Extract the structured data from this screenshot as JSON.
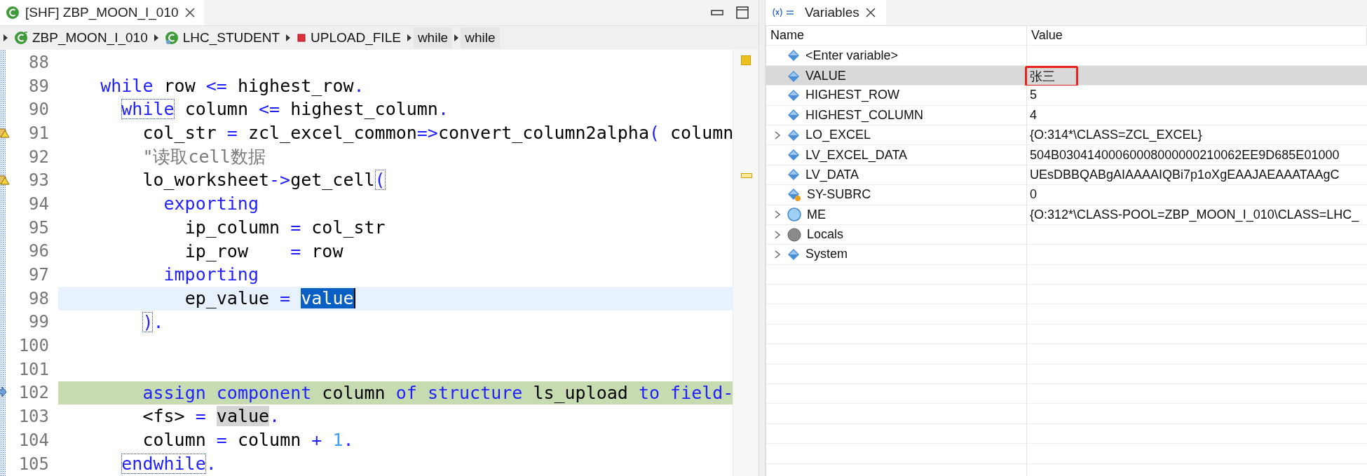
{
  "editor": {
    "tab": {
      "title": "[SHF] ZBP_MOON_I_010",
      "selected": true
    },
    "breadcrumb": [
      {
        "kind": "global-class",
        "label": "ZBP_MOON_I_010"
      },
      {
        "kind": "local-class",
        "label": "LHC_STUDENT"
      },
      {
        "kind": "method",
        "label": "UPLOAD_FILE"
      },
      {
        "kind": "block",
        "label": "while"
      },
      {
        "kind": "block",
        "label": "while"
      }
    ],
    "lines": [
      {
        "number": "88",
        "cursor_line": false,
        "execution_point": false,
        "warning": false
      },
      {
        "number": "89",
        "cursor_line": false,
        "execution_point": false,
        "warning": false,
        "tokens": [
          {
            "kind": "keyword",
            "t": "    while"
          },
          {
            "kind": "name",
            "t": " row "
          },
          {
            "kind": "operator",
            "t": "<="
          },
          {
            "kind": "name",
            "t": " highest_row"
          },
          {
            "kind": "operator",
            "t": "."
          }
        ]
      },
      {
        "number": "90",
        "cursor_line": false,
        "execution_point": false,
        "warning": false,
        "tokens": [
          {
            "kind": "keyword",
            "t": "      while",
            "matched": true
          },
          {
            "kind": "name",
            "t": " column "
          },
          {
            "kind": "operator",
            "t": "<="
          },
          {
            "kind": "name",
            "t": " highest_column"
          },
          {
            "kind": "operator",
            "t": "."
          }
        ]
      },
      {
        "number": "91",
        "cursor_line": false,
        "execution_point": false,
        "warning": true,
        "tokens": [
          {
            "kind": "name",
            "t": "        col_str"
          },
          {
            "kind": "operator",
            "t": " ="
          },
          {
            "kind": "name",
            "t": " zcl_excel_common"
          },
          {
            "kind": "operator",
            "t": "=>"
          },
          {
            "kind": "name",
            "t": "convert_column2alpha"
          },
          {
            "kind": "operator",
            "t": "("
          },
          {
            "kind": "name",
            "t": " column"
          }
        ]
      },
      {
        "number": "92",
        "cursor_line": false,
        "execution_point": false,
        "warning": false,
        "tokens": [
          {
            "kind": "comment",
            "t": "        \"读取cell数据"
          }
        ]
      },
      {
        "number": "93",
        "cursor_line": false,
        "execution_point": false,
        "warning": true,
        "tokens": [
          {
            "kind": "name",
            "t": "        lo_worksheet"
          },
          {
            "kind": "operator",
            "t": "->"
          },
          {
            "kind": "name",
            "t": "get_cell"
          },
          {
            "kind": "operator",
            "t": "(",
            "matched": true
          }
        ]
      },
      {
        "number": "94",
        "cursor_line": false,
        "execution_point": false,
        "warning": false,
        "tokens": [
          {
            "kind": "keyword",
            "t": "          exporting"
          }
        ]
      },
      {
        "number": "95",
        "cursor_line": false,
        "execution_point": false,
        "warning": false,
        "tokens": [
          {
            "kind": "name",
            "t": "            ip_column"
          },
          {
            "kind": "operator",
            "t": " ="
          },
          {
            "kind": "name",
            "t": " col_str"
          }
        ]
      },
      {
        "number": "96",
        "cursor_line": false,
        "execution_point": false,
        "warning": false,
        "tokens": [
          {
            "kind": "name",
            "t": "            ip_row"
          },
          {
            "kind": "operator",
            "t": "    ="
          },
          {
            "kind": "name",
            "t": " row"
          }
        ]
      },
      {
        "number": "97",
        "cursor_line": false,
        "execution_point": false,
        "warning": false,
        "tokens": [
          {
            "kind": "keyword",
            "t": "          importing"
          }
        ]
      },
      {
        "number": "98",
        "cursor_line": true,
        "execution_point": false,
        "warning": false,
        "tokens": [
          {
            "kind": "name",
            "t": "            ep_value"
          },
          {
            "kind": "operator",
            "t": " ="
          },
          {
            "kind": "name",
            "t": " value",
            "selected": true
          }
        ]
      },
      {
        "number": "99",
        "cursor_line": false,
        "execution_point": false,
        "warning": false,
        "tokens": [
          {
            "kind": "operator",
            "t": "        )",
            "matched": true
          },
          {
            "kind": "operator",
            "t": "."
          }
        ]
      },
      {
        "number": "100",
        "cursor_line": false,
        "execution_point": false,
        "warning": false
      },
      {
        "number": "101",
        "cursor_line": false,
        "execution_point": false,
        "warning": false
      },
      {
        "number": "102",
        "cursor_line": false,
        "execution_point": true,
        "warning": false,
        "tokens": [
          {
            "kind": "keyword",
            "t": "        assign"
          },
          {
            "kind": "keyword",
            "t": " component"
          },
          {
            "kind": "name",
            "t": " column"
          },
          {
            "kind": "keyword",
            "t": " of"
          },
          {
            "kind": "keyword",
            "t": " structure"
          },
          {
            "kind": "name",
            "t": " ls_upload"
          },
          {
            "kind": "keyword",
            "t": " to"
          },
          {
            "kind": "keyword",
            "t": " field-"
          }
        ]
      },
      {
        "number": "103",
        "cursor_line": false,
        "execution_point": false,
        "warning": false,
        "tokens": [
          {
            "kind": "name",
            "t": "        <fs>"
          },
          {
            "kind": "operator",
            "t": " ="
          },
          {
            "kind": "name",
            "t": " value",
            "occurrence": true
          },
          {
            "kind": "operator",
            "t": "."
          }
        ]
      },
      {
        "number": "104",
        "cursor_line": false,
        "execution_point": false,
        "warning": false,
        "tokens": [
          {
            "kind": "name",
            "t": "        column"
          },
          {
            "kind": "operator",
            "t": " ="
          },
          {
            "kind": "name",
            "t": " column"
          },
          {
            "kind": "operator",
            "t": " +"
          },
          {
            "kind": "number",
            "t": " 1"
          },
          {
            "kind": "operator",
            "t": "."
          }
        ]
      },
      {
        "number": "105",
        "cursor_line": false,
        "execution_point": false,
        "warning": false,
        "tokens": [
          {
            "kind": "keyword",
            "t": "      endwhile",
            "matched": true
          },
          {
            "kind": "operator",
            "t": "."
          }
        ]
      }
    ]
  },
  "variables": {
    "tab": {
      "title": "Variables",
      "selected": true
    },
    "columns": [
      "Name",
      "Value"
    ],
    "rows": [
      {
        "name": "<Enter variable>",
        "kind": "var",
        "expandable": false,
        "selected": false,
        "annotated": false
      },
      {
        "name": "VALUE",
        "value": "张三",
        "kind": "var",
        "expandable": false,
        "selected": true,
        "annotated": true
      },
      {
        "name": "HIGHEST_ROW",
        "value": "5",
        "kind": "var",
        "expandable": false,
        "selected": false,
        "annotated": false
      },
      {
        "name": "HIGHEST_COLUMN",
        "value": "4",
        "kind": "var",
        "expandable": false,
        "selected": false,
        "annotated": false
      },
      {
        "name": "LO_EXCEL",
        "value": "{O:314*\\CLASS=ZCL_EXCEL}",
        "kind": "var",
        "expandable": true,
        "selected": false,
        "annotated": false
      },
      {
        "name": "LV_EXCEL_DATA",
        "value": "504B03041400060008000000210062EE9D685E01000",
        "kind": "var",
        "expandable": false,
        "selected": false,
        "annotated": false
      },
      {
        "name": "LV_DATA",
        "value": "UEsDBBQABgAIAAAAIQBi7p1oXgEAAJAEAAATAAgC",
        "kind": "var",
        "expandable": false,
        "selected": false,
        "annotated": false
      },
      {
        "name": "SY-SUBRC",
        "value": "0",
        "kind": "changed",
        "expandable": false,
        "selected": false,
        "annotated": false
      },
      {
        "name": "ME",
        "value": "{O:312*\\CLASS-POOL=ZBP_MOON_I_010\\CLASS=LHC_",
        "kind": "object",
        "expandable": true,
        "selected": false,
        "annotated": false
      },
      {
        "name": "Locals",
        "kind": "locals",
        "expandable": true,
        "selected": false,
        "annotated": false
      },
      {
        "name": "System",
        "kind": "var",
        "expandable": true,
        "selected": false,
        "annotated": false
      }
    ]
  }
}
